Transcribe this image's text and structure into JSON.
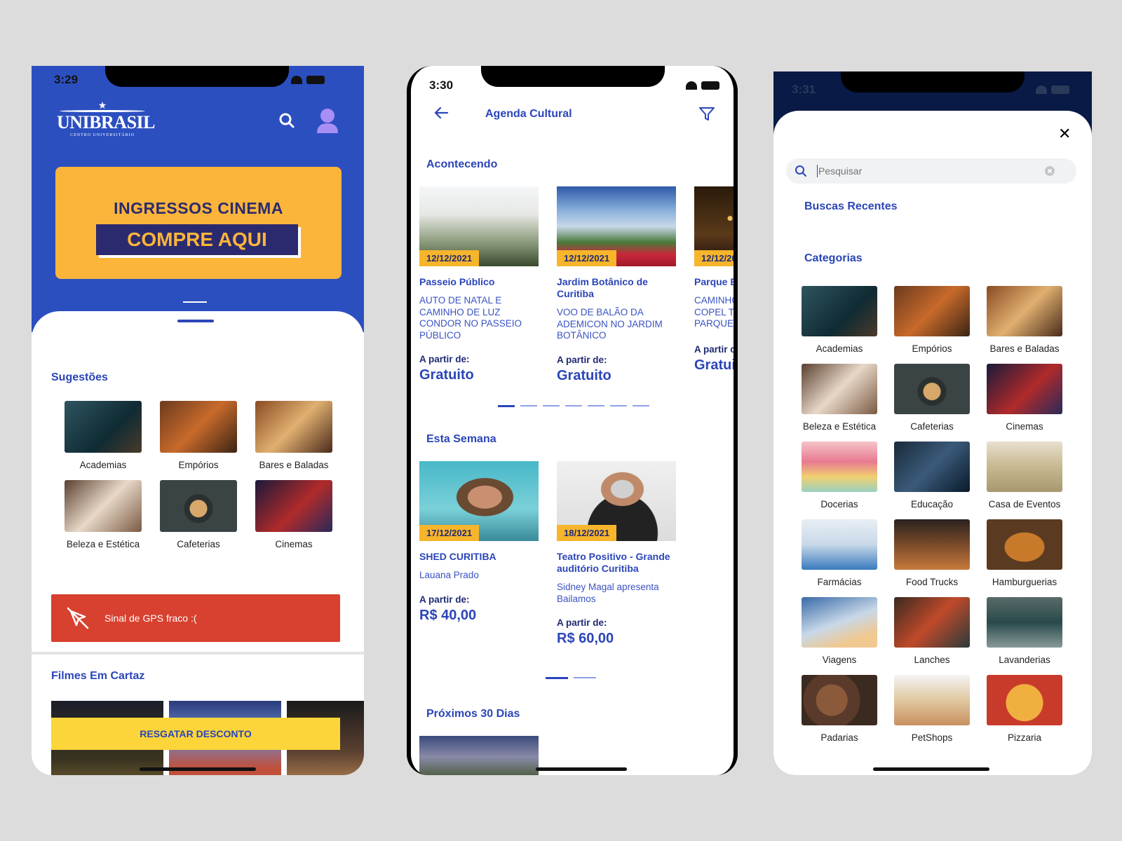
{
  "phone1": {
    "time": "3:29",
    "logo_text": "UNIBRASIL",
    "logo_sub": "CENTRO UNIVERSITÁRIO",
    "banner_line1": "INGRESSOS CINEMA",
    "banner_line2": "COMPRE AQUI",
    "suggestions_title": "Sugestões",
    "suggestions": [
      {
        "label": "Academias"
      },
      {
        "label": "Empórios"
      },
      {
        "label": "Bares e Baladas"
      },
      {
        "label": "Beleza e Estética"
      },
      {
        "label": "Cafeterias"
      },
      {
        "label": "Cinemas"
      }
    ],
    "gps_alert": "Sinal de GPS fraco :(",
    "movies_title": "Filmes Em Cartaz",
    "redeem_button": "RESGATAR DESCONTO",
    "colors": {
      "primary": "#2c4fc0",
      "banner": "#fbb53a",
      "alert": "#d8402f",
      "cta": "#fbd53a"
    }
  },
  "phone2": {
    "time": "3:30",
    "title": "Agenda Cultural",
    "section_happening": "Acontecendo",
    "happening": [
      {
        "date": "12/12/2021",
        "name": "Passeio Público",
        "desc": "AUTO DE NATAL E CAMINHO DE LUZ CONDOR NO PASSEIO PÚBLICO",
        "from": "A partir de:",
        "price": "Gratuito"
      },
      {
        "date": "12/12/2021",
        "name": "Jardim Botânico de Curitiba",
        "desc": "VOO DE BALÃO DA ADEMICON NO JARDIM BOTÂNICO",
        "from": "A partir de:",
        "price": "Gratuito"
      },
      {
        "date": "12/12/20",
        "name": "Parque E",
        "desc": "CAMINHO COPEL TI PARQUE",
        "from": "A partir c",
        "price": "Gratui"
      }
    ],
    "section_week": "Esta Semana",
    "week": [
      {
        "date": "17/12/2021",
        "name": "SHED CURITIBA",
        "desc": "Lauana Prado",
        "from": "A partir de:",
        "price": "R$ 40,00"
      },
      {
        "date": "18/12/2021",
        "name": "Teatro Positivo - Grande auditório Curitiba",
        "desc": "Sidney Magal apresenta Bailamos",
        "from": "A partir de:",
        "price": "R$ 60,00"
      }
    ],
    "section_30days": "Próximos 30 Dias"
  },
  "phone3": {
    "time": "3:31",
    "search_placeholder": "Pesquisar",
    "recent_title": "Buscas Recentes",
    "categories_title": "Categorias",
    "categories": [
      {
        "label": "Academias"
      },
      {
        "label": "Empórios"
      },
      {
        "label": "Bares e Baladas"
      },
      {
        "label": "Beleza e Estética"
      },
      {
        "label": "Cafeterias"
      },
      {
        "label": "Cinemas"
      },
      {
        "label": "Docerias"
      },
      {
        "label": "Educação"
      },
      {
        "label": "Casa de Eventos"
      },
      {
        "label": "Farmácias"
      },
      {
        "label": "Food Trucks"
      },
      {
        "label": "Hamburguerias"
      },
      {
        "label": "Viagens"
      },
      {
        "label": "Lanches"
      },
      {
        "label": "Lavanderias"
      },
      {
        "label": "Padarias"
      },
      {
        "label": "PetShops"
      },
      {
        "label": "Pizzaria"
      }
    ]
  }
}
